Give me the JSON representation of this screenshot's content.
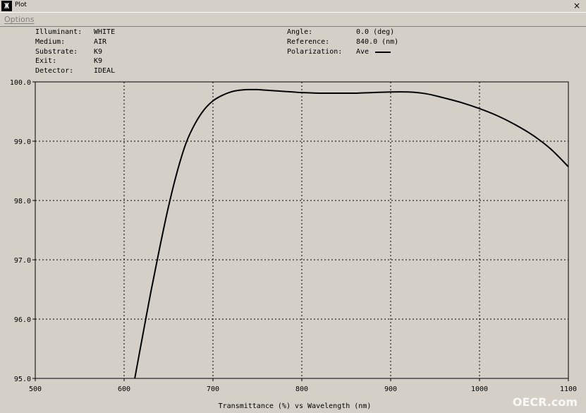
{
  "window": {
    "title": "Plot",
    "close_glyph": "×",
    "icon": "app-icon"
  },
  "menu": {
    "options_label": "Options"
  },
  "info": {
    "left_labels": [
      "Illuminant:",
      "Medium:",
      "Substrate:",
      "Exit:",
      "Detector:"
    ],
    "left_values": [
      "WHITE",
      "AIR",
      "K9",
      "K9",
      "IDEAL"
    ],
    "right_labels": [
      "Angle:",
      "Reference:",
      "Polarization:"
    ],
    "right_values": [
      "0.0 (deg)",
      "840.0 (nm)",
      "Ave"
    ]
  },
  "watermark": "OECR.com",
  "chart_data": {
    "type": "line",
    "title": "",
    "xlabel": "Transmittance (%)  vs  Wavelength (nm)",
    "ylabel": "",
    "xlim": [
      500,
      1100
    ],
    "ylim": [
      95.0,
      100.0
    ],
    "x_ticks": [
      "500",
      "600",
      "700",
      "800",
      "900",
      "1000",
      "1100"
    ],
    "y_ticks": [
      "95.0",
      "96.0",
      "97.0",
      "98.0",
      "99.0",
      "100.0"
    ],
    "grid": true,
    "line_color": "#000000",
    "series": [
      {
        "x": [
          612,
          620,
          630,
          640,
          650,
          660,
          670,
          680,
          690,
          700,
          710,
          720,
          730,
          740,
          750,
          760,
          770,
          780,
          790,
          800,
          820,
          840,
          860,
          880,
          900,
          920,
          940,
          960,
          980,
          1000,
          1020,
          1040,
          1060,
          1080,
          1100
        ],
        "values": [
          95.0,
          95.65,
          96.45,
          97.2,
          97.9,
          98.5,
          98.98,
          99.3,
          99.53,
          99.68,
          99.77,
          99.83,
          99.86,
          99.87,
          99.87,
          99.86,
          99.85,
          99.84,
          99.83,
          99.82,
          99.81,
          99.81,
          99.81,
          99.82,
          99.83,
          99.83,
          99.8,
          99.73,
          99.65,
          99.55,
          99.43,
          99.28,
          99.1,
          98.87,
          98.57
        ]
      }
    ]
  }
}
